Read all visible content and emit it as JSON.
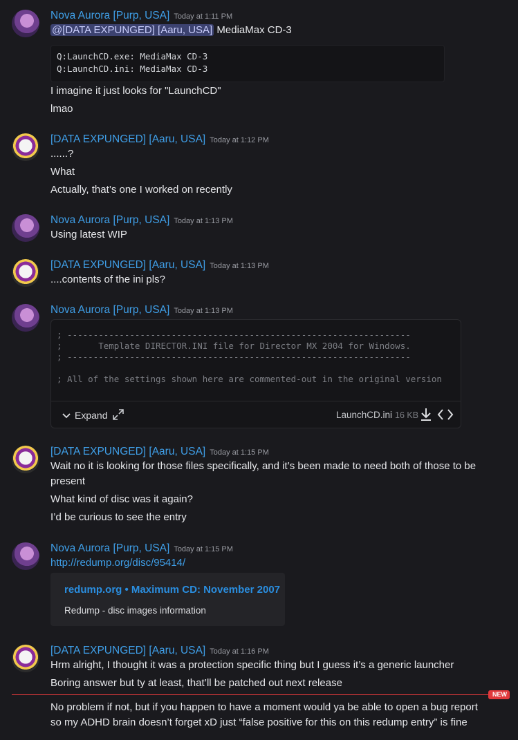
{
  "messages": [
    {
      "author": "Nova Aurora [Purp, USA]",
      "timestamp": "Today at 1:11 PM",
      "mention": "@[DATA EXPUNGED] [Aaru, USA]",
      "first_line_rest": " MediaMax CD-3",
      "code_lines": [
        "Q:LaunchCD.exe: MediaMax CD-3",
        "Q:LaunchCD.ini: MediaMax CD-3"
      ],
      "lines": [
        "I imagine it just looks for \"LaunchCD\"",
        "lmao"
      ]
    },
    {
      "author": "[DATA EXPUNGED] [Aaru, USA]",
      "timestamp": "Today at 1:12 PM",
      "lines": [
        "......?",
        "What",
        "Actually, that’s one I worked on recently"
      ]
    },
    {
      "author": "Nova Aurora [Purp, USA]",
      "timestamp": "Today at 1:13 PM",
      "lines": [
        "Using latest WIP"
      ]
    },
    {
      "author": "[DATA EXPUNGED] [Aaru, USA]",
      "timestamp": "Today at 1:13 PM",
      "lines": [
        "....contents of the ini pls?"
      ]
    },
    {
      "author": "Nova Aurora [Purp, USA]",
      "timestamp": "Today at 1:13 PM",
      "file": {
        "preview": "; ------------------------------------------------------------------\n;       Template DIRECTOR.INI file for Director MX 2004 for Windows.\n; ------------------------------------------------------------------\n\n; All of the settings shown here are commented-out in the original version",
        "expand_label": "Expand",
        "name": "LaunchCD.ini",
        "size": "16 KB"
      }
    },
    {
      "author": "[DATA EXPUNGED] [Aaru, USA]",
      "timestamp": "Today at 1:15 PM",
      "lines": [
        "Wait no it is looking for those files specifically, and it’s been made to need both of those to be",
        "present",
        "What kind of disc was it again?",
        "I’d be curious to see the entry"
      ]
    },
    {
      "author": "Nova Aurora [Purp, USA]",
      "timestamp": "Today at 1:15 PM",
      "link": "http://redump.org/disc/95414/",
      "embed": {
        "title": "redump.org • Maximum CD: November 2007",
        "description": "Redump - disc images information"
      }
    },
    {
      "author": "[DATA EXPUNGED] [Aaru, USA]",
      "timestamp": "Today at 1:16 PM",
      "lines": [
        "Hrm alright, I thought it was a protection specific thing but I guess it’s a generic launcher",
        "Boring answer but ty at least, that’ll be patched out next release",
        "No problem if not, but if you happen to have a moment would ya be able to open a bug report",
        "so my ADHD brain doesn’t forget xD just “false positive for this on this redump entry” is fine"
      ]
    }
  ],
  "new_badge": "NEW",
  "colors": {
    "author": "#3f9fe8",
    "background": "#1a1a1e",
    "new_divider": "#e2393c"
  }
}
